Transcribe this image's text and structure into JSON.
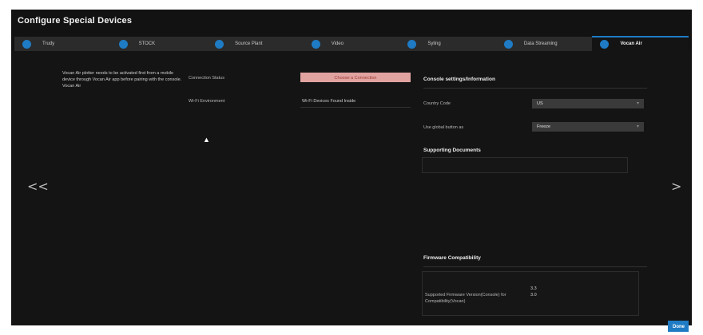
{
  "dialog": {
    "title": "Configure Special Devices",
    "done_label": "Done"
  },
  "tabs": [
    {
      "label": "Trudy",
      "active": false
    },
    {
      "label": "STOCK",
      "active": false
    },
    {
      "label": "Source Plant",
      "active": false
    },
    {
      "label": "Video",
      "active": false
    },
    {
      "label": "Syling",
      "active": false
    },
    {
      "label": "Data Streaming",
      "active": false
    },
    {
      "label": "Vocan Air",
      "active": true
    }
  ],
  "left": {
    "description": "Vocan Air plotter needs to be activated first from a mobile device through Vocan Air app before pairing with the console.",
    "device_name": "Vocan Air"
  },
  "middle": {
    "connection_status_label": "Connection Status",
    "connection_status_value": "Choose a Connection",
    "wifi_environment_label": "Wi-Fi Environment",
    "wifi_environment_value": "Wi-Fi Devices Found Inside"
  },
  "console_settings": {
    "heading": "Console settings/Information",
    "country_code_label": "Country Code",
    "country_code_value": "US",
    "use_global_button_label": "Use global button as",
    "use_global_button_value": "Freeze"
  },
  "supporting_documents": {
    "heading": "Supporting Documents"
  },
  "firmware": {
    "heading": "Firmware Compatibility",
    "label": "Supported Firmware Version(Console) for Compatibility(Vocan)",
    "versions": [
      "3.3",
      "3.0"
    ]
  },
  "nav": {
    "prev": "<<",
    "next": ">"
  },
  "colors": {
    "accent": "#1e7bc4",
    "status_button": "#e0a3a0"
  }
}
